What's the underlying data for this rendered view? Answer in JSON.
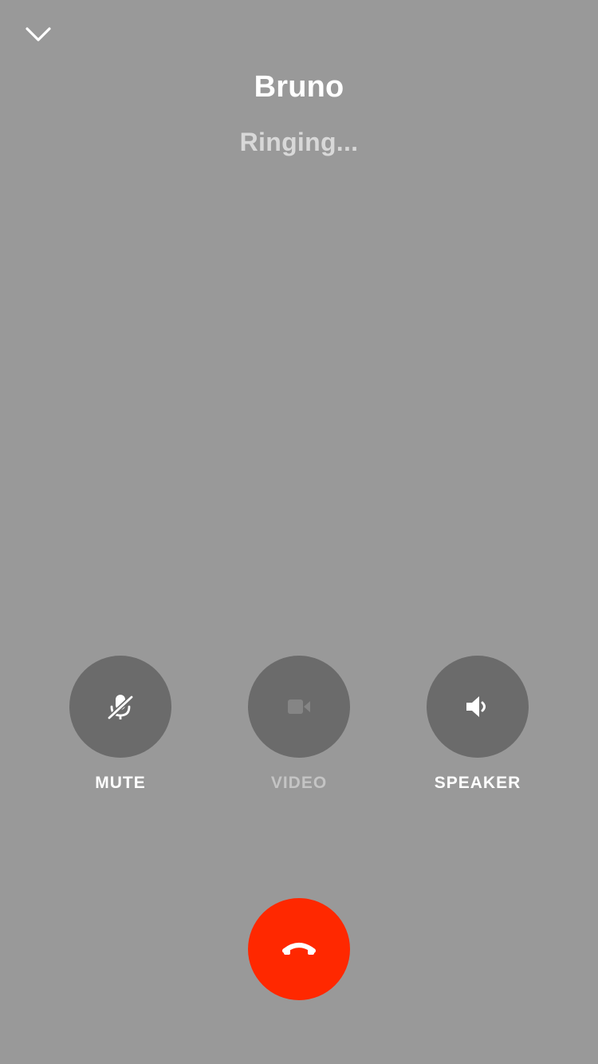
{
  "header": {
    "collapse_icon": "chevron-down-icon"
  },
  "call": {
    "caller_name": "Bruno",
    "status": "Ringing..."
  },
  "controls": [
    {
      "label": "MUTE",
      "icon": "mic-muted-icon",
      "enabled": true
    },
    {
      "label": "VIDEO",
      "icon": "video-camera-icon",
      "enabled": false
    },
    {
      "label": "SPEAKER",
      "icon": "speaker-icon",
      "enabled": true
    }
  ],
  "end_call": {
    "icon": "phone-hangup-icon"
  },
  "colors": {
    "background": "#999999",
    "control_circle": "#6b6b6b",
    "end_call": "#ff2800",
    "label_disabled": "#c4c4c4"
  }
}
